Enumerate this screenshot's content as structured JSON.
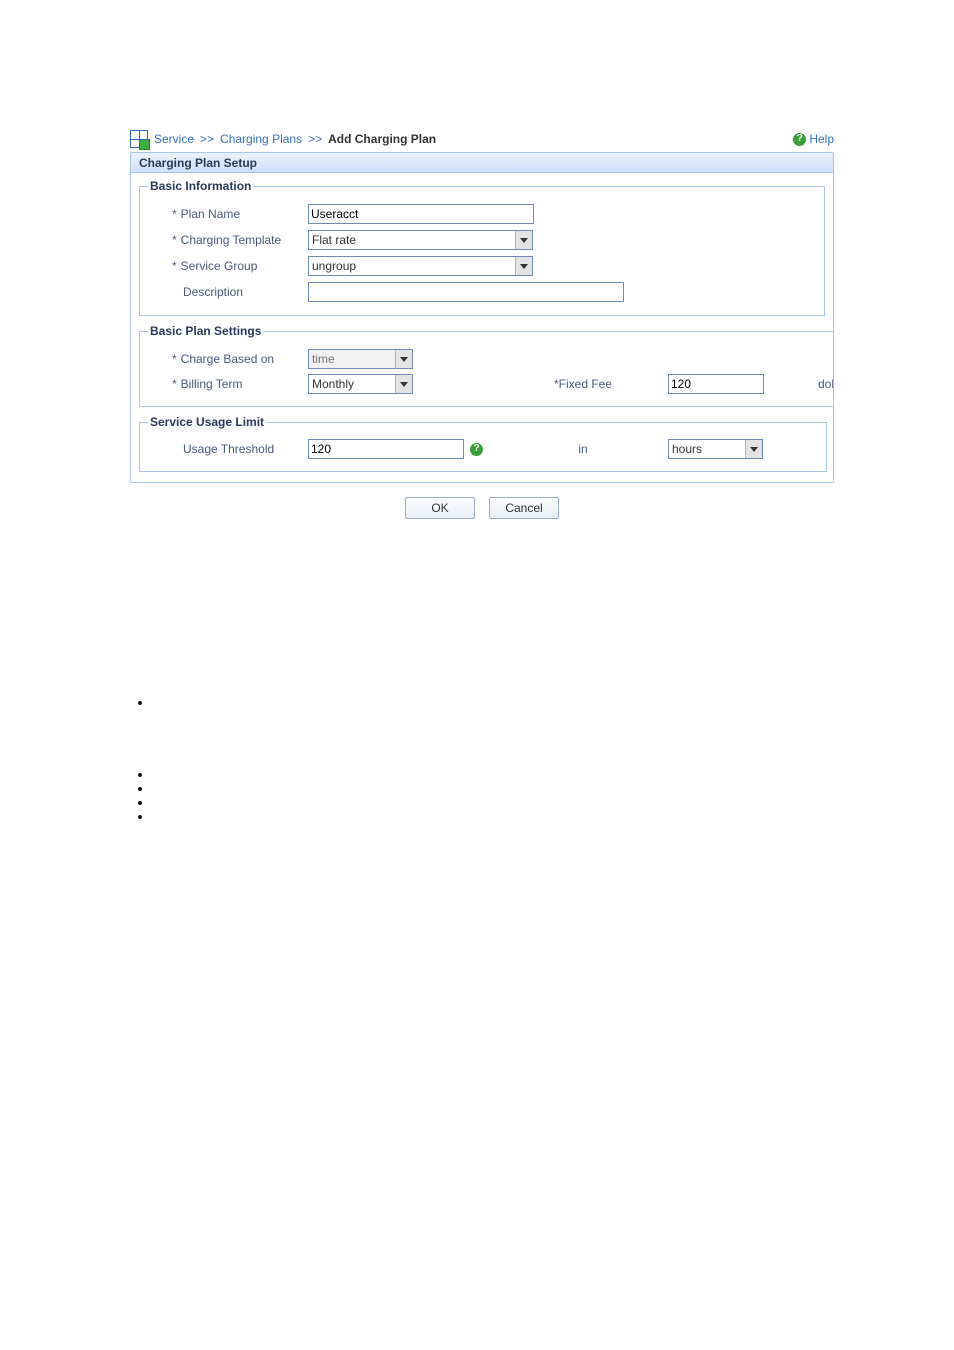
{
  "breadcrumb": {
    "service": "Service",
    "sep": ">>",
    "charging_plans": "Charging Plans",
    "add": "Add Charging Plan"
  },
  "help_label": "Help",
  "panel_title": "Charging Plan Setup",
  "groups": {
    "basic_info": {
      "legend": "Basic Information",
      "plan_name_label": "Plan Name",
      "plan_name_value": "Useracct",
      "charging_template_label": "Charging Template",
      "charging_template_value": "Flat rate",
      "service_group_label": "Service Group",
      "service_group_value": "ungroup",
      "description_label": "Description",
      "description_value": ""
    },
    "basic_plan": {
      "legend": "Basic Plan Settings",
      "charge_based_label": "Charge Based on",
      "charge_based_value": "time",
      "billing_term_label": "Billing Term",
      "billing_term_value": "Monthly",
      "fixed_fee_label": "Fixed Fee",
      "fixed_fee_value": "120",
      "fixed_fee_unit": "dollar"
    },
    "usage_limit": {
      "legend": "Service Usage Limit",
      "threshold_label": "Usage Threshold",
      "threshold_value": "120",
      "in_label": "in",
      "unit_value": "hours"
    }
  },
  "buttons": {
    "ok": "OK",
    "cancel": "Cancel"
  },
  "asterisk": "*"
}
